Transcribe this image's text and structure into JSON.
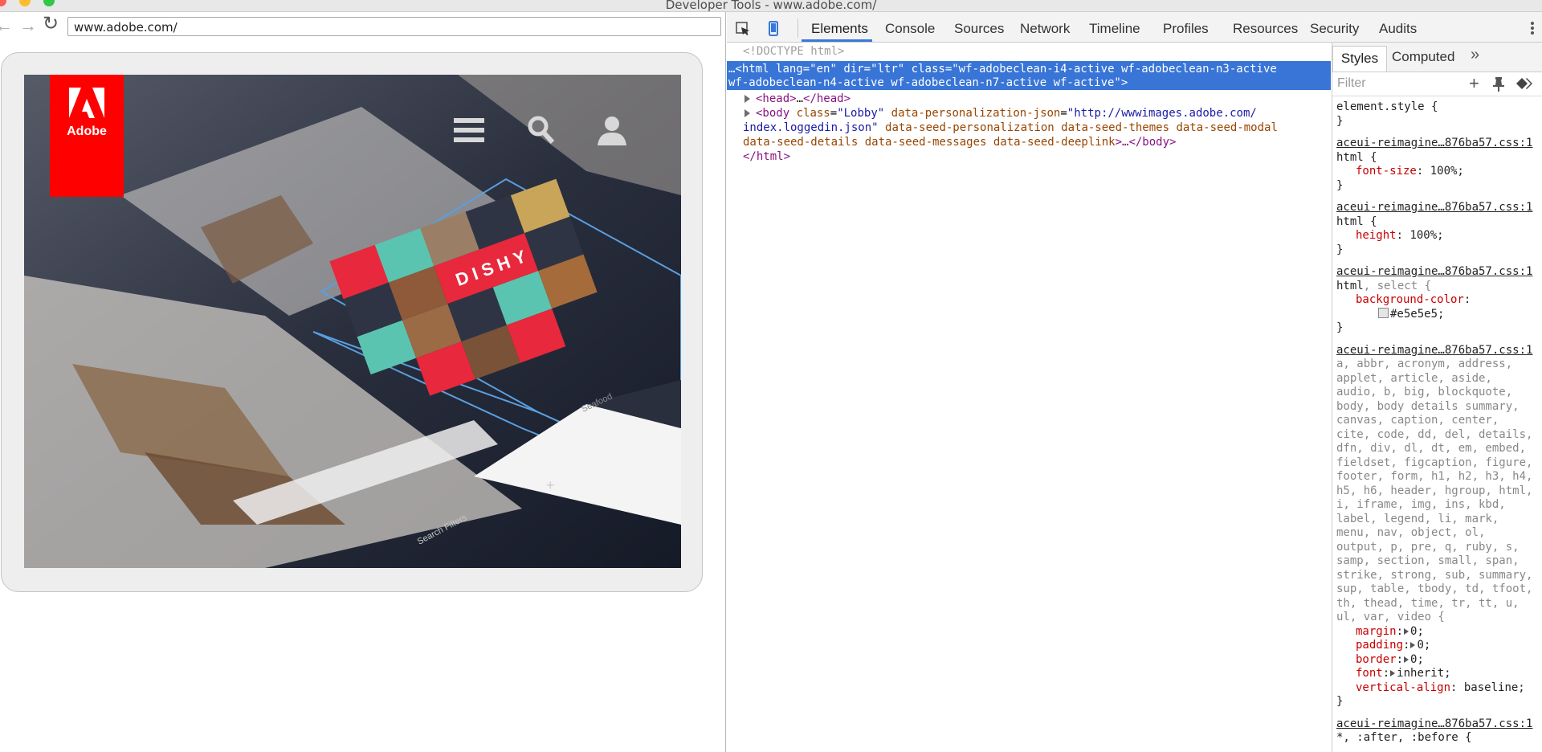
{
  "window": {
    "title": "Developer Tools - www.adobe.com/"
  },
  "browser": {
    "url": "www.adobe.com/",
    "logo_text": "Adobe",
    "hero_text": {
      "dishy": "DISHY",
      "seafood": "Seafood",
      "search_filters": "Search Filters"
    }
  },
  "devtools": {
    "tabs": [
      "Elements",
      "Console",
      "Sources",
      "Network",
      "Timeline",
      "Profiles",
      "Resources",
      "Security",
      "Audits"
    ],
    "elements": {
      "doctype": "<!DOCTYPE html>",
      "html_line1": {
        "prefix": "…<",
        "tag": "html",
        "a1": "lang",
        "v1": "\"en\"",
        "a2": "dir",
        "v2": "\"ltr\"",
        "a3": "class",
        "v3": "\"wf-adobeclean-i4-active wf-adobeclean-n3-active"
      },
      "html_line2": "wf-adobeclean-n4-active wf-adobeclean-n7-active wf-active\">",
      "head": {
        "open": "<head>",
        "ellipsis": "…",
        "close": "</head>"
      },
      "body_line1": {
        "open": "<body",
        "a1": "class",
        "v1": "\"Lobby\"",
        "a2": "data-personalization-json",
        "v2": "\"http://wwwimages.adobe.com/"
      },
      "body_line2": {
        "v": "index.loggedin.json\"",
        "attrs": "data-seed-personalization data-seed-themes data-seed-modal"
      },
      "body_line3": {
        "attrs": "data-seed-details data-seed-messages data-seed-deeplink",
        "close": ">…</body>"
      },
      "html_close": "</html>"
    },
    "styles": {
      "tabs": {
        "styles": "Styles",
        "computed": "Computed",
        "more": "»"
      },
      "filter_placeholder": "Filter",
      "element_style": {
        "selector": "element.style {",
        "close": "}"
      },
      "source": "aceui-reimagine…876ba57.css:1",
      "rules": [
        {
          "selector": "html {",
          "prop": "font-size",
          "value": "100%;"
        },
        {
          "selector": "html {",
          "prop": "height",
          "value": "100%;"
        },
        {
          "selector_main": "html",
          "selector_rest": ", select {",
          "prop": "background-color",
          "value": "#e5e5e5;"
        }
      ],
      "reset_selectors": [
        "a, abbr, acronym, address,",
        "applet, article, aside,",
        "audio, b, big, blockquote,",
        "body, body details summary,",
        "canvas, caption, center,",
        "cite, code, dd, del, details,",
        "dfn, div, dl, dt, em, embed,",
        "fieldset, figcaption, figure,",
        "footer, form, h1, h2, h3, h4,",
        "h5, h6, header, hgroup, html,",
        "i, iframe, img, ins, kbd,",
        "label, legend, li, mark,",
        "menu, nav, object, ol,",
        "output, p, pre, q, ruby, s,",
        "samp, section, small, span,",
        "strike, strong, sub, summary,",
        "sup, table, tbody, td, tfoot,",
        "th, thead, time, tr, tt, u,",
        "ul, var, video {"
      ],
      "reset_decls": [
        {
          "prop": "margin",
          "value": "0;"
        },
        {
          "prop": "padding",
          "value": "0;"
        },
        {
          "prop": "border",
          "value": "0;"
        },
        {
          "prop": "font",
          "value": "inherit;"
        },
        {
          "prop": "vertical-align",
          "value": "baseline;"
        }
      ],
      "last_selector": "*, :after, :before {",
      "close": "}"
    }
  },
  "colors": {
    "accent": "#3875d7",
    "adobe_red": "#fe0000",
    "dishy_red": "#e8283c",
    "teal": "#5bc4b0"
  }
}
